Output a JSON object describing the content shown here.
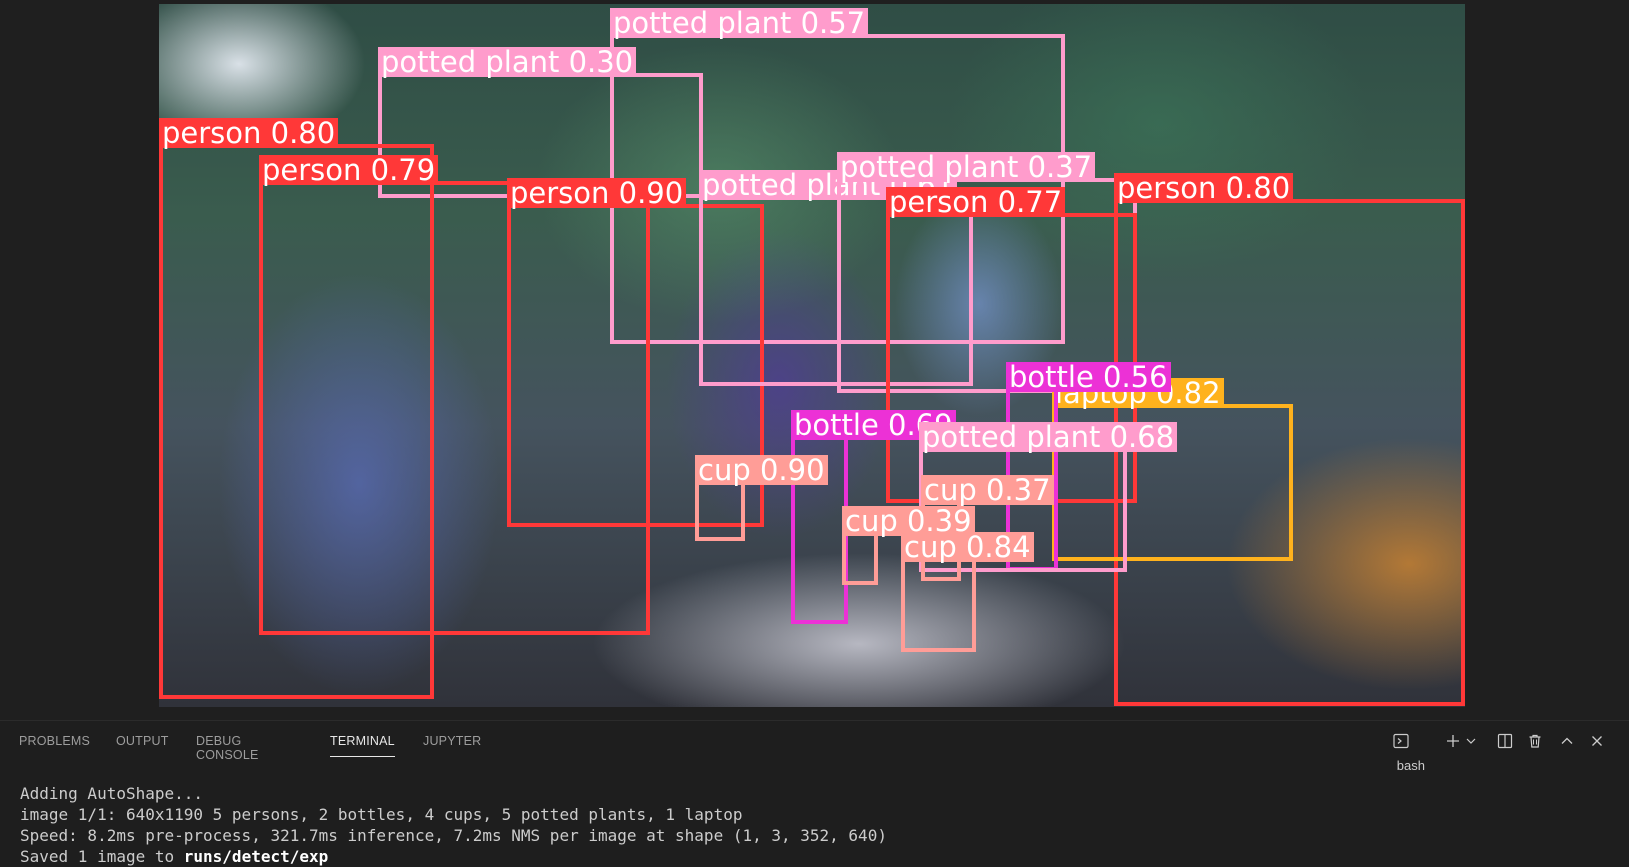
{
  "detections": [
    {
      "label": "potted plant 0.57",
      "color": "#ff9ccc",
      "labelColor": "#ff9ccc"
    },
    {
      "label": "potted plant 0.30",
      "color": "#ff9ccc",
      "labelColor": "#ff9ccc"
    },
    {
      "label": "person 0.80",
      "color": "#ff3838",
      "labelColor": "#ff3838"
    },
    {
      "label": "person 0.79",
      "color": "#ff3838",
      "labelColor": "#ff3838"
    },
    {
      "label": "person 0.90",
      "color": "#ff3838",
      "labelColor": "#ff3838"
    },
    {
      "label": "potted plant 0.61",
      "color": "#ff9ccc",
      "labelColor": "#ff9ccc"
    },
    {
      "label": "potted plant 0.37",
      "color": "#ff9ccc",
      "labelColor": "#ff9ccc"
    },
    {
      "label": "person 0.77",
      "color": "#ff3838",
      "labelColor": "#ff3838"
    },
    {
      "label": "person 0.80",
      "color": "#ff3838",
      "labelColor": "#ff3838"
    },
    {
      "label": "laptop 0.82",
      "color": "#ffb21d",
      "labelColor": "#ffb21d"
    },
    {
      "label": "bottle 0.69",
      "color": "#ec31d6",
      "labelColor": "#ec31d6"
    },
    {
      "label": "bottle 0.56",
      "color": "#ec31d6",
      "labelColor": "#ec31d6"
    },
    {
      "label": "potted plant 0.68",
      "color": "#ff9ccc",
      "labelColor": "#ff9ccc"
    },
    {
      "label": "cup 0.90",
      "color": "#ff9d97",
      "labelColor": "#ff9d97"
    },
    {
      "label": "cup 0.37",
      "color": "#ff9d97",
      "labelColor": "#ff9d97"
    },
    {
      "label": "cup 0.39",
      "color": "#ff9d97",
      "labelColor": "#ff9d97"
    },
    {
      "label": "cup 0.84",
      "color": "#ff9d97",
      "labelColor": "#ff9d97"
    }
  ],
  "panel": {
    "tabs": [
      "PROBLEMS",
      "OUTPUT",
      "DEBUG CONSOLE",
      "TERMINAL",
      "JUPYTER"
    ],
    "active_tab": "TERMINAL",
    "shell_label": "bash",
    "icons": [
      "terminal-icon",
      "add-icon",
      "chevron-down-icon",
      "split-icon",
      "trash-icon",
      "maximize-icon",
      "close-icon"
    ]
  },
  "terminal": {
    "lines": [
      "Adding AutoShape...",
      "image 1/1: 640x1190 5 persons, 2 bottles, 4 cups, 5 potted plants, 1 laptop",
      "Speed: 8.2ms pre-process, 321.7ms inference, 7.2ms NMS per image at shape (1, 3, 352, 640)"
    ],
    "saved_prefix": "Saved 1 image to ",
    "saved_path": "runs/detect/exp"
  }
}
